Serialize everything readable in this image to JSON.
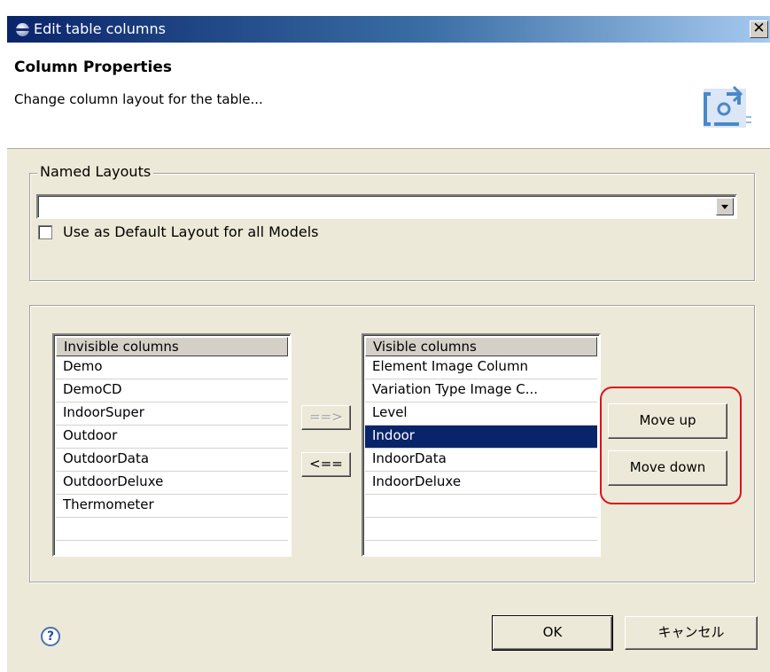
{
  "window": {
    "title": "Edit table columns",
    "close_glyph": "✕"
  },
  "header": {
    "title": "Column Properties",
    "description": "Change column layout for the table...",
    "icon": "columns-layout-icon"
  },
  "named_layouts": {
    "legend": "Named Layouts",
    "combo_value": "",
    "checkbox_label": "Use as Default Layout for all Models",
    "checkbox_checked": false
  },
  "invisible": {
    "header": "Invisible columns",
    "items": [
      "Demo",
      "DemoCD",
      "IndoorSuper",
      "Outdoor",
      "OutdoorData",
      "OutdoorDeluxe",
      "Thermometer",
      "",
      ""
    ]
  },
  "visible": {
    "header": "Visible columns",
    "items": [
      "Element Image Column",
      "Variation Type Image C...",
      "Level",
      "Indoor",
      "IndoorData",
      "IndoorDeluxe",
      "",
      "",
      ""
    ],
    "selected_index": 3
  },
  "transfer": {
    "add_label": "==>",
    "remove_label": "<=="
  },
  "move": {
    "up_label": "Move up",
    "down_label": "Move down"
  },
  "footer": {
    "help_glyph": "?",
    "ok_label": "OK",
    "cancel_label": "キャンセル"
  },
  "colors": {
    "selection": "#0a246a",
    "highlight": "#e0101a",
    "dialog_bg": "#ece9d8"
  }
}
